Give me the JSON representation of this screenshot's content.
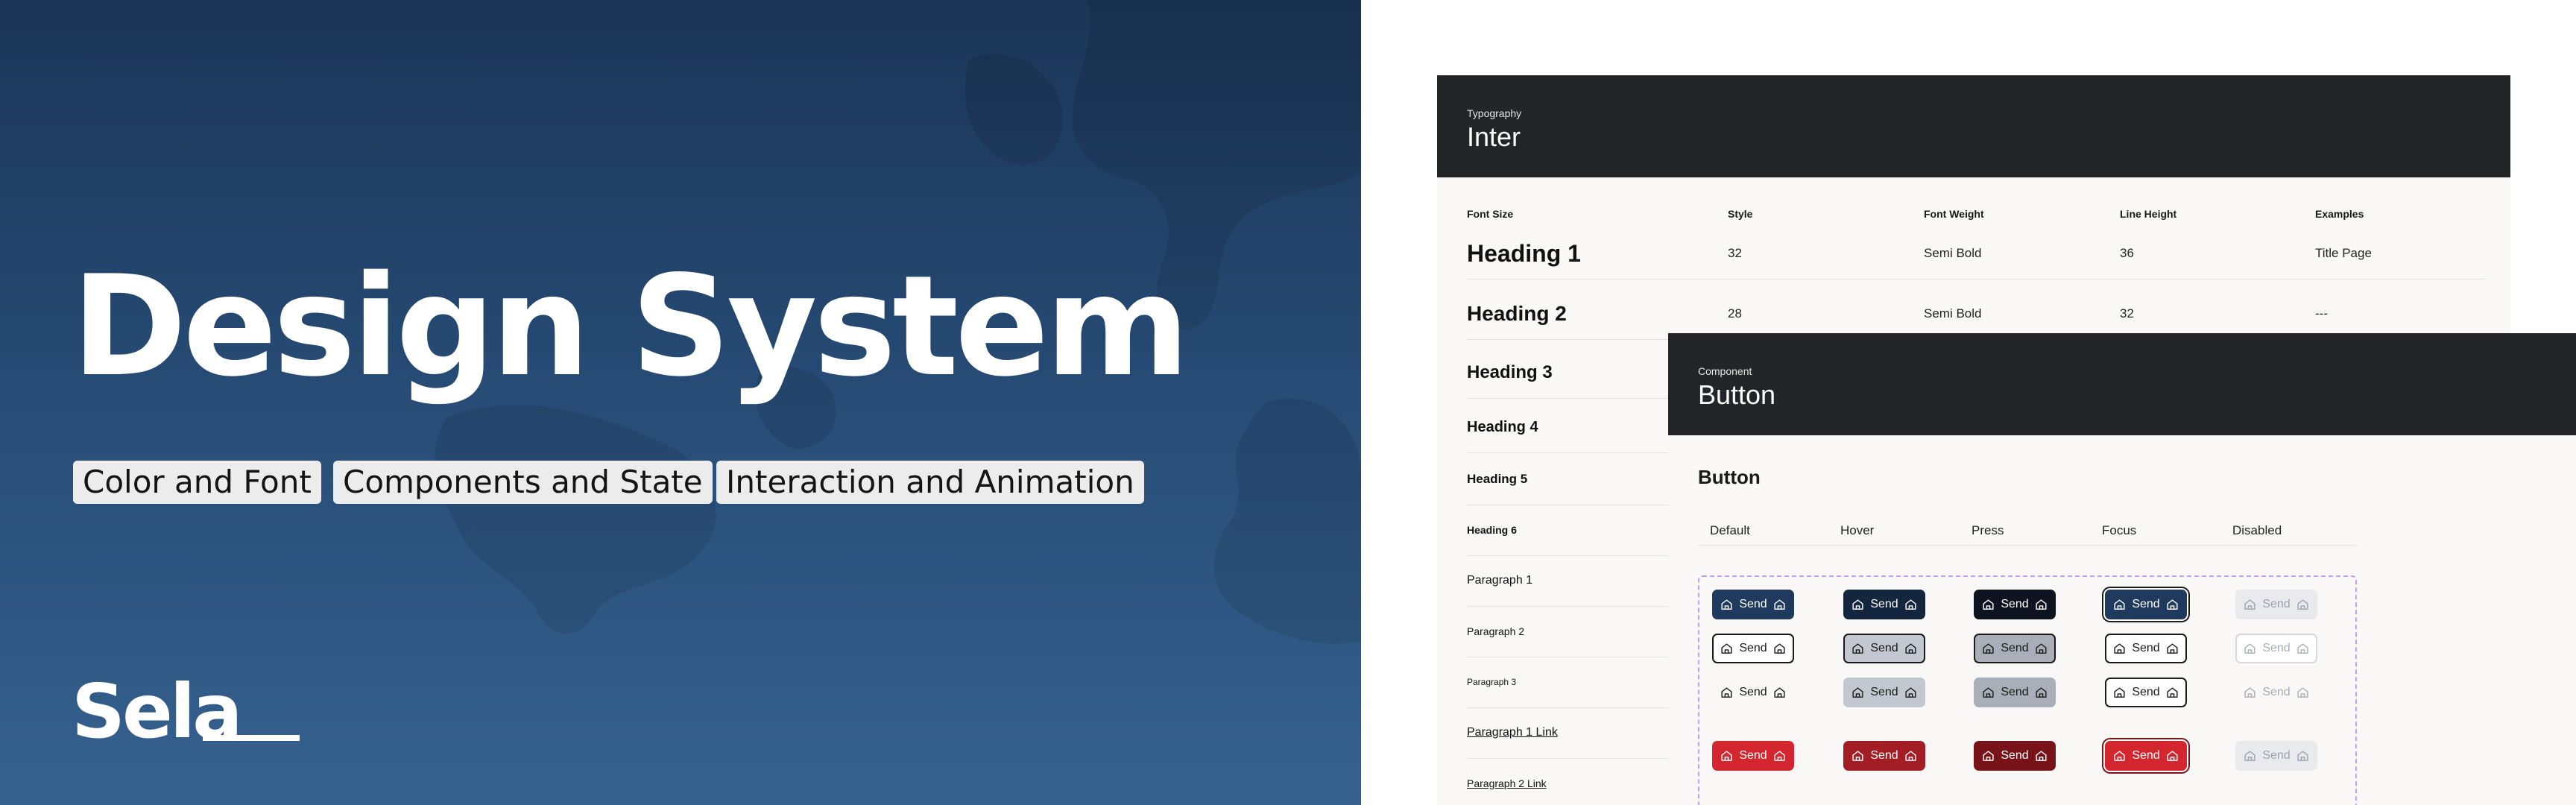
{
  "hero": {
    "title": "Design System",
    "chips": [
      "Color and Font",
      "Components and State",
      "Interaction and Animation"
    ],
    "brand": "Sela",
    "background_color": "#264a73"
  },
  "typography_card": {
    "kicker": "Typography",
    "title": "Inter",
    "columns": [
      "Font Size",
      "Style",
      "Font Weight",
      "Line Height",
      "Examples"
    ],
    "rows": [
      {
        "name": "Heading 1",
        "style": "32",
        "weight": "Semi Bold",
        "line_height": "36",
        "example": "Title Page"
      },
      {
        "name": "Heading 2",
        "style": "28",
        "weight": "Semi Bold",
        "line_height": "32",
        "example": "---"
      },
      {
        "name": "Heading 3"
      },
      {
        "name": "Heading 4"
      },
      {
        "name": "Heading 5"
      },
      {
        "name": "Heading 6"
      },
      {
        "name": "Paragraph 1"
      },
      {
        "name": "Paragraph 2"
      },
      {
        "name": "Paragraph 3"
      },
      {
        "name": "Paragraph 1 Link"
      },
      {
        "name": "Paragraph 2 Link"
      }
    ]
  },
  "button_card": {
    "kicker": "Component",
    "title": "Button",
    "section_title": "Button",
    "states": [
      "Default",
      "Hover",
      "Press",
      "Focus",
      "Disabled"
    ],
    "button_label": "Send",
    "icon": "home-icon",
    "variants": [
      "primary",
      "secondary",
      "ghost",
      "danger"
    ],
    "colors": {
      "primary": "#203a5e",
      "danger": "#d3262f",
      "focus_outline": "#1a1a1a",
      "frame_dash": "#c29cf3"
    }
  }
}
